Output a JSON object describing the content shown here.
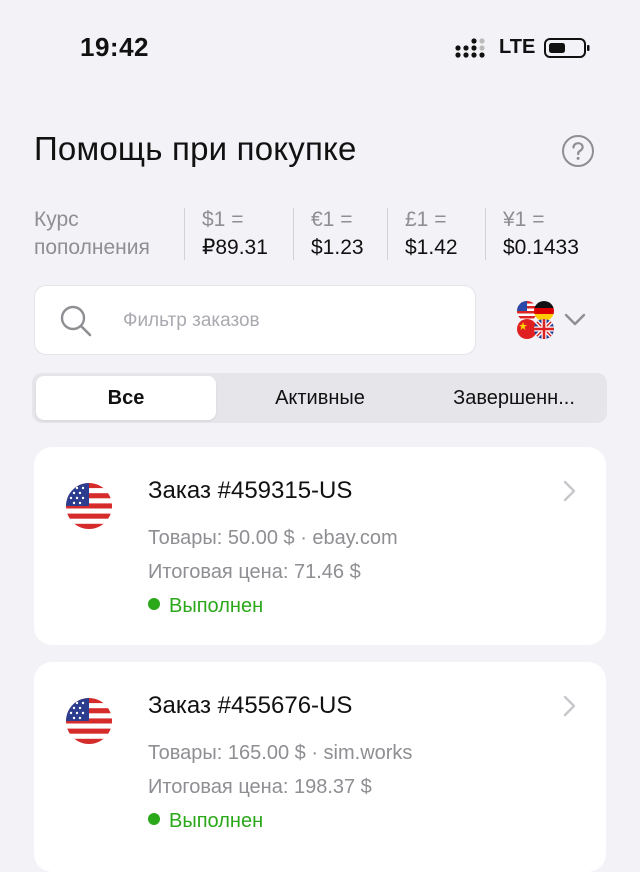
{
  "status_bar": {
    "time": "19:42",
    "network": "LTE",
    "icons": [
      "signal-icon",
      "battery-icon"
    ]
  },
  "header": {
    "title": "Помощь при покупке",
    "help_icon": "question-circle-icon"
  },
  "rates": {
    "label": "Курс пополнения",
    "items": [
      {
        "key": "$1 =",
        "value": "₽89.31"
      },
      {
        "key": "€1 =",
        "value": "$1.23"
      },
      {
        "key": "£1 =",
        "value": "$1.42"
      },
      {
        "key": "¥1 =",
        "value": "$0.1433"
      }
    ]
  },
  "search": {
    "placeholder": "Фильтр заказов",
    "value": "",
    "icon": "search-icon"
  },
  "country_filter": {
    "flags": [
      "us-flag-icon",
      "de-flag-icon",
      "cn-flag-icon",
      "uk-flag-icon"
    ],
    "icon": "chevron-down-icon"
  },
  "tabs": [
    {
      "label": "Все",
      "active": true
    },
    {
      "label": "Активные",
      "active": false
    },
    {
      "label": "Завершенн...",
      "active": false
    }
  ],
  "orders": [
    {
      "title": "Заказ #459315-US",
      "goods": "Товары: 50.00 $ · ebay.com",
      "total": "Итоговая цена: 71.46 $",
      "status": "Выполнен",
      "flag": "us-flag-icon"
    },
    {
      "title": "Заказ #455676-US",
      "goods": "Товары: 165.00 $ · sim.works",
      "total": "Итоговая цена: 198.37 $",
      "status": "Выполнен",
      "flag": "us-flag-icon"
    }
  ],
  "colors": {
    "background": "#f2f2f7",
    "card": "#ffffff",
    "status_green": "#2aa81a",
    "secondary_text": "#8e8e93"
  }
}
